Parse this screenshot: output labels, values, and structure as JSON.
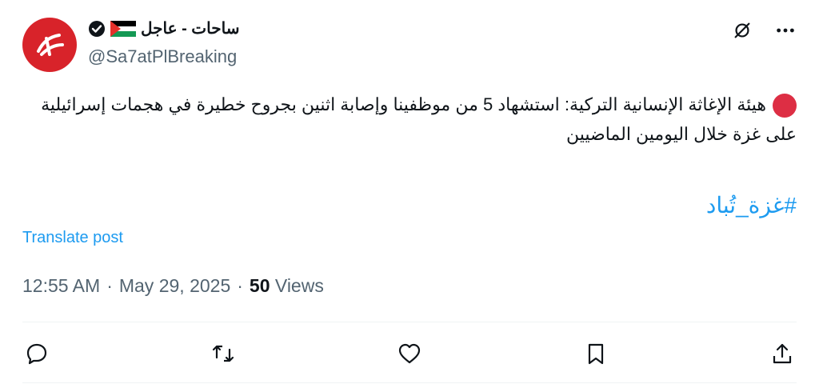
{
  "author": {
    "display_name": "ساحات - عاجل",
    "handle": "@Sa7atPlBreaking",
    "verified": true,
    "flag": "palestine-flag"
  },
  "tweet": {
    "text": "هيئة الإغاثة الإنسانية التركية: استشهاد 5 من موظفينا وإصابة اثنين بجروح خطيرة في هجمات إسرائيلية على غزة خلال اليومين الماضيين",
    "hashtag": "#غزة_تُباد"
  },
  "translate_label": "Translate post",
  "meta": {
    "time": "12:55 AM",
    "date": "May 29, 2025",
    "views_count": "50",
    "views_label": "Views"
  },
  "colors": {
    "accent": "#1d9bf0",
    "avatar_bg": "#d8232a",
    "dot": "#dd2e44"
  },
  "icons": [
    "grok-icon",
    "more-icon",
    "reply-icon",
    "retweet-icon",
    "like-icon",
    "bookmark-icon",
    "share-icon"
  ]
}
